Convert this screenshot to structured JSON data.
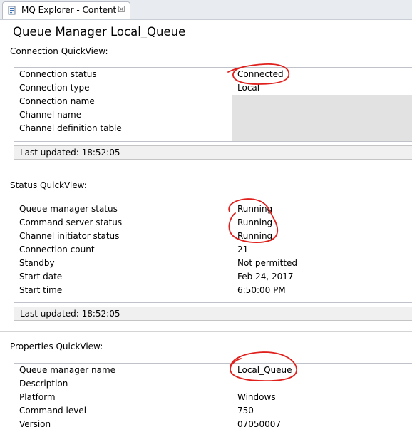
{
  "tab": {
    "title": "MQ Explorer - Content",
    "close_glyph": "☒",
    "icon": "mq-explorer-icon"
  },
  "page_title": "Queue Manager Local_Queue",
  "sections": {
    "connection": {
      "title": "Connection QuickView:",
      "rows": [
        {
          "label": "Connection status",
          "value": "Connected"
        },
        {
          "label": "Connection type",
          "value": "Local"
        },
        {
          "label": "Connection name",
          "value": ""
        },
        {
          "label": "Channel name",
          "value": ""
        },
        {
          "label": "Channel definition table",
          "value": ""
        }
      ],
      "last_updated": "Last updated: 18:52:05"
    },
    "status": {
      "title": "Status QuickView:",
      "rows": [
        {
          "label": "Queue manager status",
          "value": "Running"
        },
        {
          "label": "Command server status",
          "value": "Running"
        },
        {
          "label": "Channel initiator status",
          "value": "Running"
        },
        {
          "label": "Connection count",
          "value": "21"
        },
        {
          "label": "Standby",
          "value": "Not permitted"
        },
        {
          "label": "Start date",
          "value": "Feb 24, 2017"
        },
        {
          "label": "Start time",
          "value": "6:50:00 PM"
        }
      ],
      "last_updated": "Last updated: 18:52:05"
    },
    "properties": {
      "title": "Properties QuickView:",
      "rows": [
        {
          "label": "Queue manager name",
          "value": "Local_Queue"
        },
        {
          "label": "Description",
          "value": ""
        },
        {
          "label": "Platform",
          "value": "Windows"
        },
        {
          "label": "Command level",
          "value": "750"
        },
        {
          "label": "Version",
          "value": "07050007"
        }
      ]
    }
  },
  "colors": {
    "annotation": "#e0201c",
    "empty_cell": "#e2e2e2",
    "border": "#bfc3c9"
  }
}
